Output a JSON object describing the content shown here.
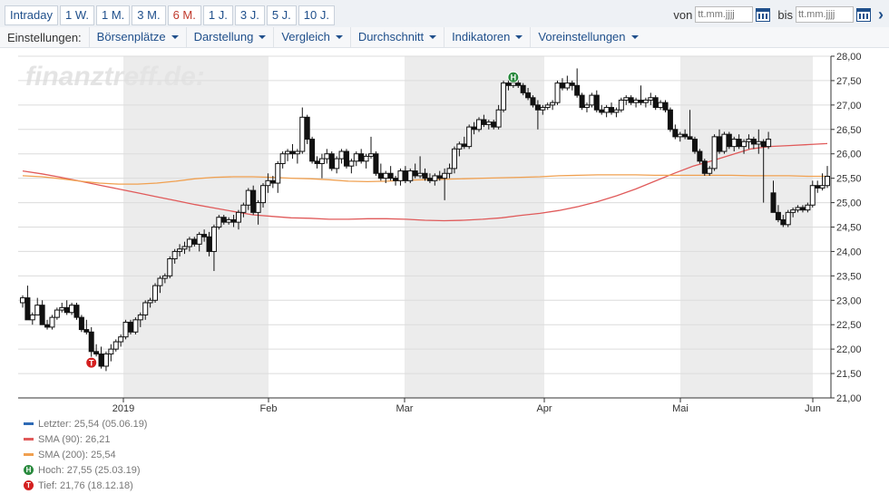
{
  "toolbar": {
    "ranges": [
      "Intraday",
      "1 W.",
      "1 M.",
      "3 M.",
      "6 M.",
      "1 J.",
      "3 J.",
      "5 J.",
      "10 J."
    ],
    "active_range": "6 M.",
    "from_label": "von",
    "to_label": "bis",
    "date_placeholder": "tt.mm.jjjj"
  },
  "settings": {
    "label": "Einstellungen:",
    "menus": [
      "Börsenplätze",
      "Darstellung",
      "Vergleich",
      "Durchschnitt",
      "Indikatoren",
      "Voreinstellungen"
    ]
  },
  "watermark": "finanztreff.de:",
  "chart_data": {
    "type": "candlestick",
    "ylim": [
      21.0,
      28.0
    ],
    "y_ticks": [
      "28,00",
      "27,50",
      "27,00",
      "26,50",
      "26,00",
      "25,50",
      "25,00",
      "24,50",
      "24,00",
      "23,50",
      "23,00",
      "22,50",
      "22,00",
      "21,50",
      "21,00"
    ],
    "x_tick_labels": [
      "2019",
      "Feb",
      "Mar",
      "Apr",
      "Mai",
      "Jun"
    ],
    "grid": true,
    "shaded_months": [
      "Jan",
      "Mar",
      "Mai"
    ],
    "candles": [
      [
        22.95,
        23.1,
        22.85,
        23.05
      ],
      [
        23.05,
        23.3,
        22.6,
        22.6
      ],
      [
        22.6,
        22.75,
        22.5,
        22.7
      ],
      [
        22.7,
        23.05,
        22.7,
        22.9
      ],
      [
        22.9,
        23.0,
        22.5,
        22.5
      ],
      [
        22.5,
        22.6,
        22.4,
        22.45
      ],
      [
        22.45,
        22.7,
        22.4,
        22.65
      ],
      [
        22.65,
        22.85,
        22.6,
        22.8
      ],
      [
        22.8,
        22.95,
        22.75,
        22.85
      ],
      [
        22.85,
        23.0,
        22.7,
        22.75
      ],
      [
        22.75,
        22.95,
        22.7,
        22.9
      ],
      [
        22.9,
        22.95,
        22.6,
        22.65
      ],
      [
        22.65,
        22.7,
        22.35,
        22.4
      ],
      [
        22.4,
        22.6,
        22.3,
        22.35
      ],
      [
        22.35,
        22.45,
        21.76,
        21.95
      ],
      [
        21.95,
        22.1,
        21.85,
        21.9
      ],
      [
        21.9,
        22.05,
        21.6,
        21.65
      ],
      [
        21.65,
        21.95,
        21.55,
        21.9
      ],
      [
        21.9,
        22.1,
        21.75,
        22.0
      ],
      [
        22.0,
        22.2,
        21.95,
        22.15
      ],
      [
        22.15,
        22.3,
        22.05,
        22.25
      ],
      [
        22.25,
        22.6,
        22.2,
        22.55
      ],
      [
        22.55,
        22.6,
        22.3,
        22.35
      ],
      [
        22.35,
        22.65,
        22.3,
        22.6
      ],
      [
        22.6,
        22.75,
        22.45,
        22.7
      ],
      [
        22.7,
        23.0,
        22.6,
        22.95
      ],
      [
        22.95,
        23.05,
        22.85,
        23.0
      ],
      [
        23.0,
        23.35,
        22.95,
        23.3
      ],
      [
        23.3,
        23.5,
        23.15,
        23.45
      ],
      [
        23.45,
        23.55,
        23.35,
        23.5
      ],
      [
        23.5,
        23.9,
        23.45,
        23.85
      ],
      [
        23.85,
        24.05,
        23.75,
        24.0
      ],
      [
        24.0,
        24.15,
        23.9,
        24.05
      ],
      [
        24.05,
        24.2,
        23.95,
        24.1
      ],
      [
        24.1,
        24.3,
        24.0,
        24.25
      ],
      [
        24.25,
        24.3,
        24.1,
        24.15
      ],
      [
        24.15,
        24.4,
        24.0,
        24.35
      ],
      [
        24.35,
        24.45,
        24.2,
        24.3
      ],
      [
        24.3,
        24.4,
        23.9,
        24.0
      ],
      [
        24.0,
        24.55,
        23.6,
        24.5
      ],
      [
        24.5,
        24.75,
        24.45,
        24.7
      ],
      [
        24.7,
        24.75,
        24.55,
        24.6
      ],
      [
        24.6,
        24.7,
        24.55,
        24.65
      ],
      [
        24.65,
        24.75,
        24.5,
        24.6
      ],
      [
        24.6,
        24.85,
        24.45,
        24.8
      ],
      [
        24.8,
        25.0,
        24.7,
        24.95
      ],
      [
        24.95,
        25.3,
        24.85,
        25.25
      ],
      [
        25.25,
        25.35,
        24.75,
        24.8
      ],
      [
        24.8,
        25.05,
        24.55,
        25.0
      ],
      [
        25.0,
        25.4,
        24.9,
        25.35
      ],
      [
        25.35,
        25.6,
        25.2,
        25.45
      ],
      [
        25.45,
        25.55,
        25.3,
        25.4
      ],
      [
        25.4,
        25.85,
        25.2,
        25.8
      ],
      [
        25.8,
        26.05,
        25.7,
        26.0
      ],
      [
        26.0,
        26.1,
        25.85,
        26.05
      ],
      [
        26.05,
        26.2,
        25.9,
        26.0
      ],
      [
        26.0,
        26.1,
        25.8,
        26.05
      ],
      [
        26.05,
        26.95,
        26.0,
        26.75
      ],
      [
        26.75,
        26.8,
        26.2,
        26.3
      ],
      [
        26.3,
        26.35,
        25.8,
        25.85
      ],
      [
        25.85,
        25.95,
        25.7,
        25.8
      ],
      [
        25.8,
        26.0,
        25.5,
        25.9
      ],
      [
        25.9,
        26.1,
        25.8,
        26.0
      ],
      [
        26.0,
        26.05,
        25.65,
        25.7
      ],
      [
        25.7,
        25.95,
        25.6,
        25.9
      ],
      [
        25.9,
        26.1,
        25.8,
        26.05
      ],
      [
        26.05,
        26.1,
        25.7,
        25.75
      ],
      [
        25.75,
        25.9,
        25.6,
        25.85
      ],
      [
        25.85,
        26.05,
        25.75,
        26.0
      ],
      [
        26.0,
        26.1,
        25.8,
        25.85
      ],
      [
        25.85,
        26.0,
        25.7,
        25.95
      ],
      [
        25.95,
        26.35,
        25.9,
        26.0
      ],
      [
        26.0,
        26.05,
        25.55,
        25.6
      ],
      [
        25.6,
        25.8,
        25.45,
        25.5
      ],
      [
        25.5,
        25.65,
        25.4,
        25.6
      ],
      [
        25.6,
        25.75,
        25.45,
        25.5
      ],
      [
        25.5,
        25.55,
        25.35,
        25.45
      ],
      [
        25.45,
        25.7,
        25.35,
        25.65
      ],
      [
        25.65,
        25.75,
        25.4,
        25.45
      ],
      [
        25.45,
        25.7,
        25.4,
        25.65
      ],
      [
        25.65,
        25.8,
        25.5,
        25.55
      ],
      [
        25.55,
        25.95,
        25.5,
        25.6
      ],
      [
        25.6,
        25.7,
        25.45,
        25.5
      ],
      [
        25.5,
        25.6,
        25.4,
        25.45
      ],
      [
        25.45,
        25.6,
        25.35,
        25.55
      ],
      [
        25.55,
        25.65,
        25.45,
        25.5
      ],
      [
        25.5,
        25.7,
        25.05,
        25.6
      ],
      [
        25.6,
        25.8,
        25.5,
        25.7
      ],
      [
        25.7,
        26.15,
        25.6,
        26.1
      ],
      [
        26.1,
        26.25,
        25.95,
        26.2
      ],
      [
        26.2,
        26.35,
        26.1,
        26.15
      ],
      [
        26.15,
        26.6,
        26.1,
        26.55
      ],
      [
        26.55,
        26.65,
        26.4,
        26.5
      ],
      [
        26.5,
        26.75,
        26.45,
        26.7
      ],
      [
        26.7,
        26.8,
        26.55,
        26.6
      ],
      [
        26.6,
        26.7,
        26.5,
        26.65
      ],
      [
        26.65,
        26.7,
        26.5,
        26.55
      ],
      [
        26.55,
        27.0,
        26.5,
        26.9
      ],
      [
        26.9,
        27.5,
        26.85,
        27.45
      ],
      [
        27.45,
        27.55,
        27.3,
        27.4
      ],
      [
        27.4,
        27.5,
        27.35,
        27.45
      ],
      [
        27.45,
        27.55,
        27.35,
        27.4
      ],
      [
        27.4,
        27.45,
        27.2,
        27.25
      ],
      [
        27.25,
        27.35,
        27.1,
        27.15
      ],
      [
        27.15,
        27.2,
        26.95,
        27.0
      ],
      [
        27.0,
        27.1,
        26.5,
        26.9
      ],
      [
        26.9,
        27.0,
        26.8,
        26.95
      ],
      [
        26.95,
        27.05,
        26.9,
        27.0
      ],
      [
        27.0,
        27.1,
        26.9,
        27.05
      ],
      [
        27.05,
        27.5,
        27.0,
        27.45
      ],
      [
        27.45,
        27.55,
        27.3,
        27.35
      ],
      [
        27.35,
        27.6,
        27.3,
        27.45
      ],
      [
        27.45,
        27.5,
        27.3,
        27.4
      ],
      [
        27.4,
        27.75,
        27.15,
        27.2
      ],
      [
        27.2,
        27.25,
        26.9,
        26.95
      ],
      [
        26.95,
        27.05,
        26.85,
        27.0
      ],
      [
        27.0,
        27.25,
        26.95,
        27.2
      ],
      [
        27.2,
        27.3,
        26.85,
        26.9
      ],
      [
        26.9,
        27.0,
        26.8,
        26.85
      ],
      [
        26.85,
        27.0,
        26.75,
        26.95
      ],
      [
        26.95,
        27.05,
        26.8,
        26.85
      ],
      [
        26.85,
        26.95,
        26.75,
        26.9
      ],
      [
        26.9,
        27.15,
        26.85,
        27.1
      ],
      [
        27.1,
        27.2,
        27.0,
        27.15
      ],
      [
        27.15,
        27.2,
        27.0,
        27.05
      ],
      [
        27.05,
        27.15,
        26.95,
        27.1
      ],
      [
        27.1,
        27.4,
        27.0,
        27.05
      ],
      [
        27.05,
        27.15,
        26.95,
        27.1
      ],
      [
        27.1,
        27.25,
        27.0,
        27.15
      ],
      [
        27.15,
        27.2,
        26.9,
        26.95
      ],
      [
        26.95,
        27.1,
        26.9,
        27.05
      ],
      [
        27.05,
        27.1,
        26.85,
        26.9
      ],
      [
        26.9,
        26.95,
        26.45,
        26.5
      ],
      [
        26.5,
        26.6,
        26.3,
        26.35
      ],
      [
        26.35,
        26.45,
        26.25,
        26.4
      ],
      [
        26.4,
        26.5,
        26.3,
        26.35
      ],
      [
        26.35,
        26.9,
        26.3,
        26.3
      ],
      [
        26.3,
        26.35,
        26.0,
        26.05
      ],
      [
        26.05,
        26.1,
        25.8,
        25.85
      ],
      [
        25.85,
        25.9,
        25.55,
        25.6
      ],
      [
        25.6,
        25.75,
        25.55,
        25.7
      ],
      [
        25.7,
        26.4,
        25.65,
        26.35
      ],
      [
        26.35,
        26.5,
        26.0,
        26.05
      ],
      [
        26.05,
        26.45,
        26.0,
        26.4
      ],
      [
        26.4,
        26.45,
        26.1,
        26.15
      ],
      [
        26.15,
        26.35,
        26.05,
        26.3
      ],
      [
        26.3,
        26.4,
        26.1,
        26.15
      ],
      [
        26.15,
        26.3,
        26.0,
        26.25
      ],
      [
        26.25,
        26.4,
        26.1,
        26.3
      ],
      [
        26.3,
        26.35,
        26.1,
        26.2
      ],
      [
        26.2,
        26.5,
        26.0,
        26.25
      ],
      [
        26.25,
        26.3,
        25.0,
        26.15
      ],
      [
        26.15,
        26.45,
        26.1,
        26.3
      ],
      [
        25.2,
        25.45,
        24.8,
        24.8
      ],
      [
        24.8,
        24.95,
        24.6,
        24.65
      ],
      [
        24.65,
        24.75,
        24.5,
        24.55
      ],
      [
        24.55,
        24.85,
        24.5,
        24.8
      ],
      [
        24.8,
        24.9,
        24.7,
        24.85
      ],
      [
        24.85,
        24.95,
        24.8,
        24.9
      ],
      [
        24.9,
        24.95,
        24.8,
        24.85
      ],
      [
        24.85,
        25.0,
        24.8,
        24.95
      ],
      [
        24.95,
        25.45,
        24.9,
        25.35
      ],
      [
        25.35,
        25.45,
        25.2,
        25.3
      ],
      [
        25.3,
        25.6,
        25.25,
        25.35
      ],
      [
        25.35,
        25.75,
        25.3,
        25.54
      ]
    ],
    "series": [
      {
        "name": "SMA (90)",
        "color": "#e05a5a",
        "values": [
          25.65,
          25.59,
          25.52,
          25.44,
          25.36,
          25.28,
          25.2,
          25.12,
          25.04,
          24.96,
          24.89,
          24.82,
          24.75,
          24.72,
          24.69,
          24.68,
          24.66,
          24.66,
          24.67,
          24.67,
          24.66,
          24.64,
          24.63,
          24.64,
          24.66,
          24.69,
          24.74,
          24.78,
          24.84,
          24.92,
          25.02,
          25.14,
          25.28,
          25.44,
          25.6,
          25.75,
          25.86,
          25.98,
          26.1,
          26.15,
          26.17,
          26.19,
          26.21
        ]
      },
      {
        "name": "SMA (200)",
        "color": "#f0a050",
        "values": [
          25.55,
          25.53,
          25.49,
          25.44,
          25.4,
          25.38,
          25.38,
          25.4,
          25.44,
          25.49,
          25.52,
          25.53,
          25.53,
          25.52,
          25.5,
          25.49,
          25.47,
          25.44,
          25.43,
          25.44,
          25.46,
          25.47,
          25.48,
          25.49,
          25.5,
          25.51,
          25.52,
          25.53,
          25.55,
          25.56,
          25.57,
          25.57,
          25.57,
          25.56,
          25.56,
          25.56,
          25.56,
          25.56,
          25.55,
          25.55,
          25.55,
          25.54,
          25.54
        ]
      }
    ],
    "markers": [
      {
        "label": "H",
        "candle": 100,
        "value": 27.55,
        "color": "#2a8a3e"
      },
      {
        "label": "T",
        "candle": 14,
        "value": 21.76,
        "color": "#d42020"
      }
    ]
  },
  "legend": [
    {
      "kind": "line",
      "color": "#2e6ab5",
      "text": "Letzter: 25,54 (05.06.19)"
    },
    {
      "kind": "line",
      "color": "#e05a5a",
      "text": "SMA (90): 26,21"
    },
    {
      "kind": "line",
      "color": "#f0a050",
      "text": "SMA (200): 25,54"
    },
    {
      "kind": "badge",
      "color": "#2a8a3e",
      "badge": "H",
      "text": "Hoch: 27,55 (25.03.19)"
    },
    {
      "kind": "badge",
      "color": "#d42020",
      "badge": "T",
      "text": "Tief: 21,76 (18.12.18)"
    }
  ]
}
